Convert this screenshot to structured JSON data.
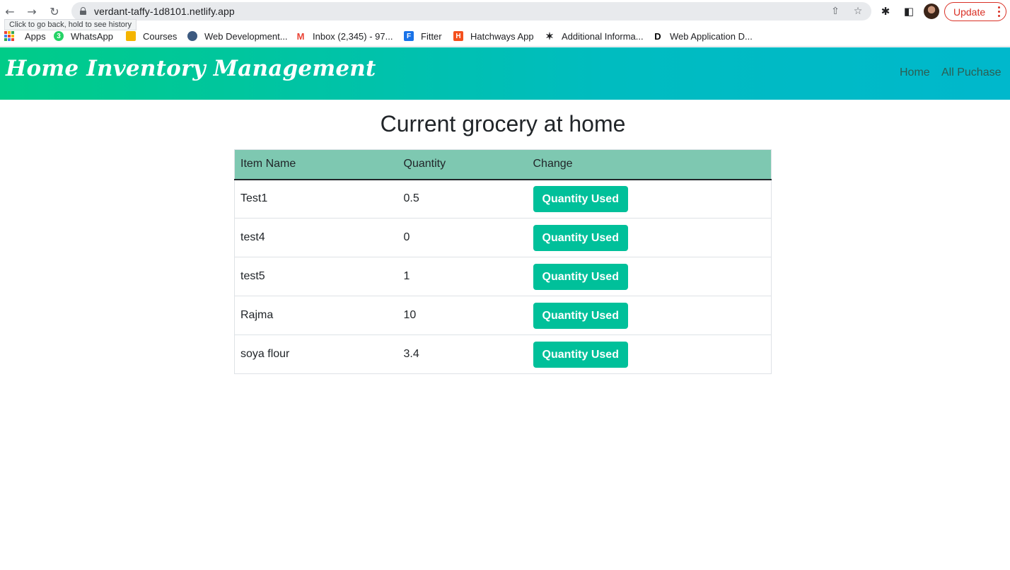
{
  "browser": {
    "url": "verdant-taffy-1d8101.netlify.app",
    "tooltip": "Click to go back, hold to see history",
    "update_label": "Update",
    "bookmarks": [
      {
        "label": "Apps"
      },
      {
        "label": "WhatsApp",
        "badge": "3"
      },
      {
        "label": "Courses"
      },
      {
        "label": "Web Development..."
      },
      {
        "label": "Inbox (2,345) - 97..."
      },
      {
        "label": "Fitter"
      },
      {
        "label": "Hatchways App"
      },
      {
        "label": "Additional Informa..."
      },
      {
        "label": "Web Application D..."
      }
    ]
  },
  "header": {
    "brand": "Home Inventory Management",
    "nav": [
      {
        "label": "Home"
      },
      {
        "label": "All Puchase"
      }
    ],
    "gradient_start": "#00cc88",
    "gradient_end": "#00b8cc"
  },
  "main": {
    "title": "Current grocery at home",
    "columns": [
      "Item Name",
      "Quantity",
      "Change"
    ],
    "rows": [
      {
        "name": "Test1",
        "quantity": "0.5",
        "low": true,
        "action": "Quantity Used"
      },
      {
        "name": "test4",
        "quantity": "0",
        "low": true,
        "action": "Quantity Used"
      },
      {
        "name": "test5",
        "quantity": "1",
        "low": true,
        "action": "Quantity Used"
      },
      {
        "name": "Rajma",
        "quantity": "10",
        "low": false,
        "action": "Quantity Used"
      },
      {
        "name": "soya flour",
        "quantity": "3.4",
        "low": false,
        "action": "Quantity Used"
      }
    ],
    "low_stock_color": "#dc143c",
    "button_color": "#00c09a",
    "table_header_color": "#7ec8b1"
  }
}
